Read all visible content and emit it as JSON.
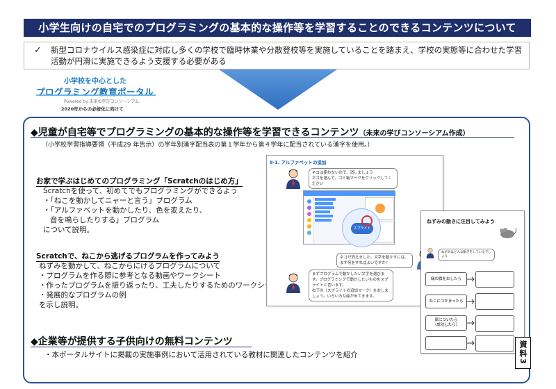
{
  "header": {
    "title": "小学生向けの自宅でのプログラミングの基本的な操作等を学習することのできるコンテンツについて"
  },
  "intro": {
    "check": "✓",
    "text": "新型コロナウイルス感染症に対応し多くの学校で臨時休業や分散登校等を実施していることを踏まえ、学校の実態等に合わせた学習活動が円滑に実施できるよう支援する必要がある"
  },
  "logo": {
    "top": "小学校を中心とした",
    "main": "プログラミング教育ポータル",
    "powered": "Powered by 未来の学びコンソーシアム",
    "year": "2020年からの必修化に向けて"
  },
  "section1": {
    "heading": "◆児童が自宅等でプログラミングの基本的な操作等を学習できるコンテンツ",
    "heading_sub": "（未来の学びコンソーシアム作成）",
    "note": "（小学校学習指導要領（平成29 年告示）の学年別漢字配当表の第１学年から第４学年に配当されている漢字を使用。）"
  },
  "scratch_intro": {
    "title": "お家で学ぶはじめてのプログラミング「Scratchのはじめ方」",
    "lines": [
      "Scratchを使って、初めてでもプログラミングができるよう",
      "・「ねこを動かしてニャーと言う」プログラム",
      "・「アルファベットを動かしたり、色を変えたり、",
      "音を鳴らしたりする」プログラム",
      "について説明。"
    ]
  },
  "scratch_escape": {
    "title": "Scratchで、ねこから逃げるプログラムを作ってみよう",
    "lines": [
      "ねずみを動かして、ねこからにげるプログラムについて",
      "・プログラムを作る際に参考となる動画やワークシート",
      "・作ったプログラムを振り返ったり、工夫したりするためのワークシート",
      "・発展的なプログラムの例",
      "を示し説明。"
    ]
  },
  "screenshot1": {
    "title": "8-1. アルファベットの追加",
    "bubble_top": "ネコは使わないので、消しましょう\nネコを選んで、ゴミ箱マークをクリックしてください",
    "bubble_mid": "ネコが消えました。文字を動かすには、まず何をすればよいですか？",
    "bubble_bottom": "まずプログラムで動かしたい文字を選びます。プログラミングで動かしたいものをスプライトと言います。\n右下の（スプライトの追加マーク）をおしましょう。いろいろな絵が出てきます。",
    "sprite_button": "スプライト"
  },
  "screenshot2": {
    "title": "ねずみの動きに注目してみよう",
    "prompt": "ねずみはどんな動きをしているでしょう",
    "conditions": [
      "緑の旗をおしたら",
      "ねこにつかまったら",
      "家についたら\n（成功したら）",
      ""
    ]
  },
  "section2": {
    "heading": "◆企業等が提供する子供向けの無料コンテンツ",
    "bullet": "・本ポータルサイトに掲載の実施事例において活用されている教材に関連したコンテンツを紹介"
  },
  "badge": {
    "text": "資料3"
  },
  "colors": {
    "title_bg": "#1f2f6b",
    "box_border": "#2a5596",
    "arrow": "#3d7fd0",
    "logo_blue": "#1a6fb5"
  }
}
